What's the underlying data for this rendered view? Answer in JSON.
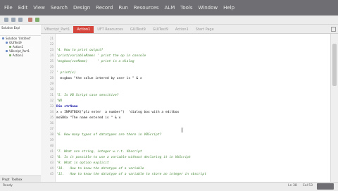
{
  "menu": [
    "File",
    "Edit",
    "View",
    "Search",
    "Design",
    "Record",
    "Run",
    "Resources",
    "ALM",
    "Tools",
    "Window",
    "Help"
  ],
  "sidebar": {
    "title": "Solution Expl",
    "items": [
      {
        "label": "Solution 'Untitled'",
        "indent": 0
      },
      {
        "label": "GUITest9",
        "indent": 1
      },
      {
        "label": "Action1",
        "indent": 2
      },
      {
        "label": "VBscript_Part1",
        "indent": 1
      },
      {
        "label": "Action1",
        "indent": 2
      }
    ],
    "bottom_tabs": [
      "Propt",
      "Toolbox"
    ]
  },
  "tabs": [
    {
      "label": "VBscript_Part1",
      "active": false
    },
    {
      "label": "Action1",
      "active": true
    },
    {
      "label": "UFT Resources",
      "active": false
    },
    {
      "label": "GUITest9",
      "active": false
    },
    {
      "label": "GUITest9",
      "active": false
    },
    {
      "label": "Action1",
      "active": false
    },
    {
      "label": "Start Page",
      "active": false
    }
  ],
  "code_lines": [
    {
      "n": "21",
      "text": "",
      "type": "plain"
    },
    {
      "n": "22",
      "text": "",
      "type": "plain"
    },
    {
      "n": "23",
      "text": "'4. How to print output?",
      "type": "comment"
    },
    {
      "n": "24",
      "text": "'print(variableName) ' print the op in console",
      "type": "comment"
    },
    {
      "n": "25",
      "text": "'msgbox(varName)     ' print in a dialog",
      "type": "comment"
    },
    {
      "n": "26",
      "text": "",
      "type": "plain"
    },
    {
      "n": "27",
      "text": "' print(x)",
      "type": "comment"
    },
    {
      "n": "28",
      "text": "  msgbox \"the value intered by user is \" & x",
      "type": "mixed"
    },
    {
      "n": "29",
      "text": "",
      "type": "plain"
    },
    {
      "n": "30",
      "text": "",
      "type": "plain"
    },
    {
      "n": "31",
      "text": "'5. Is VB Script case sensitive?",
      "type": "comment"
    },
    {
      "n": "32",
      "text": "'NO",
      "type": "comment"
    },
    {
      "n": "33",
      "text": "Dim strName",
      "type": "keyword"
    },
    {
      "n": "34",
      "text": "x = INPUTBOX(\"plz enter  a number\")  'dialog box with a editbox",
      "type": "mixed"
    },
    {
      "n": "35",
      "text": "msGBOx \"The name entered is \" & x",
      "type": "mixed"
    },
    {
      "n": "36",
      "text": "",
      "type": "plain"
    },
    {
      "n": "37",
      "text": "",
      "type": "plain"
    },
    {
      "n": "38",
      "text": "'6. How many types of datatypes are there in VBScript?",
      "type": "comment"
    },
    {
      "n": "39",
      "text": "",
      "type": "plain"
    },
    {
      "n": "40",
      "text": "",
      "type": "plain"
    },
    {
      "n": "41",
      "text": "'7. What are string, integer w.r.t. Vbscript",
      "type": "comment"
    },
    {
      "n": "42",
      "text": "'8. Is it possible to use a variable without declaring it in VbScript",
      "type": "comment"
    },
    {
      "n": "43",
      "text": "'9. What is option explicit",
      "type": "comment"
    },
    {
      "n": "44",
      "text": "'10.   How to know the datatype of a variable",
      "type": "comment"
    },
    {
      "n": "45",
      "text": "'11.   How to know the datatype of a variable to store an integer in vbscript",
      "type": "comment"
    }
  ],
  "status": {
    "left": "Ready",
    "ln": "Ln 38",
    "col": "Col 53"
  },
  "colors": {
    "accent": "#d6453c",
    "menubar": "#6f6f73"
  }
}
